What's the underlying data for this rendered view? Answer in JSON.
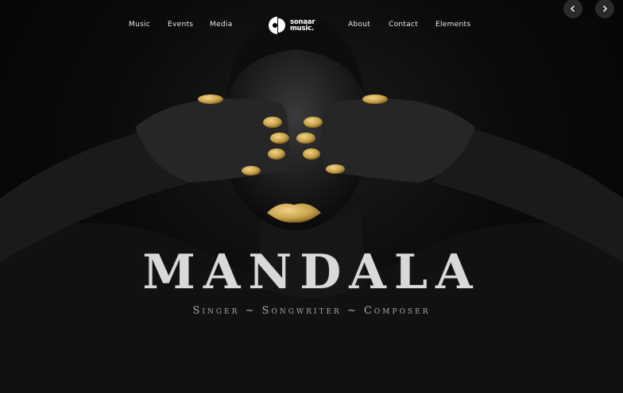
{
  "nav": {
    "items": [
      {
        "label": "Music"
      },
      {
        "label": "Events"
      },
      {
        "label": "Media"
      },
      {
        "label": "About"
      },
      {
        "label": "Contact"
      },
      {
        "label": "Elements"
      }
    ],
    "logo": {
      "line1": "sonaar",
      "line2": "music."
    }
  },
  "slider": {
    "prev_icon": "chevron-left-icon",
    "next_icon": "chevron-right-icon"
  },
  "hero": {
    "title": "MANDALA",
    "subtitle": "Singer ~ Songwriter ~ Composer"
  },
  "colors": {
    "background": "#050505",
    "gold": "#c9a24a",
    "text": "#e9e9e9"
  }
}
